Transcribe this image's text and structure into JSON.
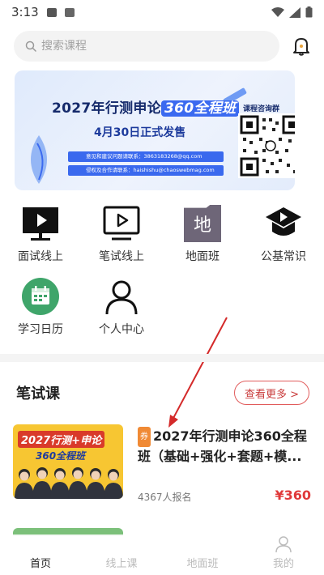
{
  "status_bar": {
    "time": "3:13"
  },
  "search": {
    "placeholder": "搜索课程"
  },
  "banner": {
    "title_prefix": "2027年行测申论",
    "title_highlight": "360全程班",
    "release": "4月30日正式发售",
    "consult_group": "课程咨询群",
    "contact_1": "意见和建议问题请联系：3863183268@qq.com",
    "contact_2": "侵权及合作请联系：haishishu@chaoswebmag.com"
  },
  "grid": [
    {
      "label": "面试线上",
      "icon": "monitor-play-icon"
    },
    {
      "label": "笔试线上",
      "icon": "tv-play-icon"
    },
    {
      "label": "地面班",
      "icon": "di-badge-icon",
      "badge_char": "地"
    },
    {
      "label": "公基常识",
      "icon": "cap-play-icon"
    },
    {
      "label": "学习日历",
      "icon": "calendar-icon"
    },
    {
      "label": "个人中心",
      "icon": "person-icon"
    }
  ],
  "section": {
    "title": "笔试课",
    "more_label": "查看更多 >"
  },
  "course": {
    "coupon": "券",
    "title": "2027年行测申论360全程班（基础+强化+套题+模...",
    "enroll_count": "4367人报名",
    "price": "¥360",
    "thumb_text_1": "2027行测+申论",
    "thumb_text_2": "360全程班"
  },
  "tab_bar": {
    "tabs": [
      {
        "label": "首页",
        "active": true
      },
      {
        "label": "线上课",
        "active": false
      },
      {
        "label": "地面班",
        "active": false
      },
      {
        "label": "我的",
        "active": false
      }
    ]
  },
  "colors": {
    "accent": "#e0393a",
    "banner_blue": "#3b6af0",
    "coupon": "#f08a35"
  }
}
